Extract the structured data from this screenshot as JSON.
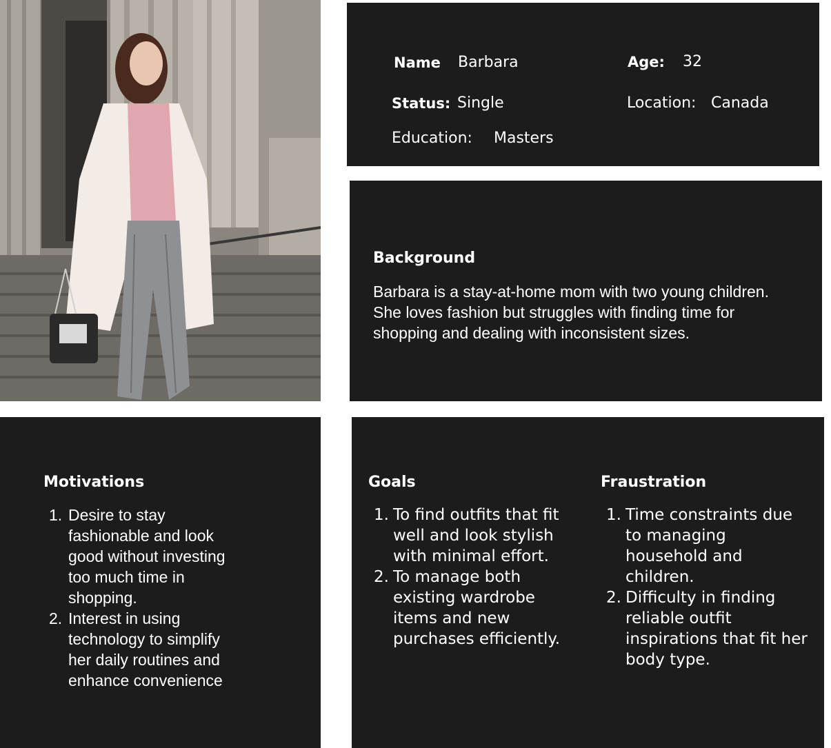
{
  "profile": {
    "name_label": "Name",
    "name_value": "Barbara",
    "age_label": "Age:",
    "age_value": "32",
    "status_label": "Status:",
    "status_value": "Single",
    "location_label": "Location:",
    "location_value": "Canada",
    "education_label": "Education:",
    "education_value": "Masters"
  },
  "background": {
    "title": "Background",
    "text": "Barbara is a stay-at-home mom with two young children. She loves fashion but struggles with finding time for shopping and dealing with inconsistent sizes."
  },
  "motivations": {
    "title": "Motivations",
    "items": [
      {
        "num": "1.",
        "text": "Desire to stay fashionable and look good without investing too much time in shopping."
      },
      {
        "num": "2.",
        "text": "Interest in using technology to simplify her daily routines and enhance convenience"
      }
    ]
  },
  "goals": {
    "title": "Goals",
    "items": [
      {
        "num": "1.",
        "text": "To find outfits that fit well and look stylish with minimal effort."
      },
      {
        "num": "2.",
        "text": " To manage both existing wardrobe items and new purchases efficiently."
      }
    ]
  },
  "frustration": {
    "title": "Fraustration",
    "items": [
      {
        "num": "1.",
        "text": "Time constraints due to managing household and children."
      },
      {
        "num": "2.",
        "text": " Difficulty in finding reliable outfit inspirations that fit her body type."
      }
    ]
  },
  "colors": {
    "panel": "#1c1c1c",
    "text": "#ffffff"
  }
}
